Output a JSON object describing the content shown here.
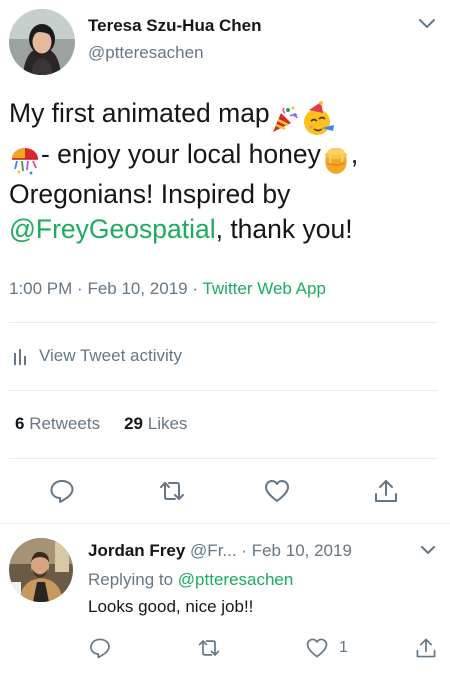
{
  "tweet": {
    "author_name": "Teresa Szu-Hua Chen",
    "author_handle": "@ptteresachen",
    "text_part1": "My first animated map",
    "text_part2": "- enjoy your local honey",
    "text_part3": ", Oregonians!  Inspired by",
    "mention": "@FreyGeospatial",
    "text_part4": ", thank you!",
    "time": "1:00 PM",
    "date": "Feb 10, 2019",
    "app": "Twitter Web App",
    "activity_label": "View Tweet activity",
    "retweets_count": "6",
    "retweets_label": "Retweets",
    "likes_count": "29",
    "likes_label": "Likes"
  },
  "reply": {
    "author_name": "Jordan Frey",
    "author_handle": "@Fr...",
    "date": "Feb 10, 2019",
    "replying_to_label": "Replying to",
    "replying_to_handle": "@ptteresachen",
    "text": "Looks good, nice job!!",
    "like_count": "1"
  },
  "icons": {
    "caret": "chevron-down-icon",
    "reply": "reply-icon",
    "retweet": "retweet-icon",
    "like": "heart-icon",
    "share": "share-icon",
    "activity": "bar-chart-icon",
    "emoji_1": "party-popper-emoji",
    "emoji_2": "partying-face-emoji",
    "emoji_3": "confetti-ball-emoji",
    "emoji_4": "honey-pot-emoji"
  },
  "colors": {
    "accent": "#1aac5f",
    "text": "#14171a",
    "muted": "#657786",
    "divider": "#e6ecf0"
  }
}
